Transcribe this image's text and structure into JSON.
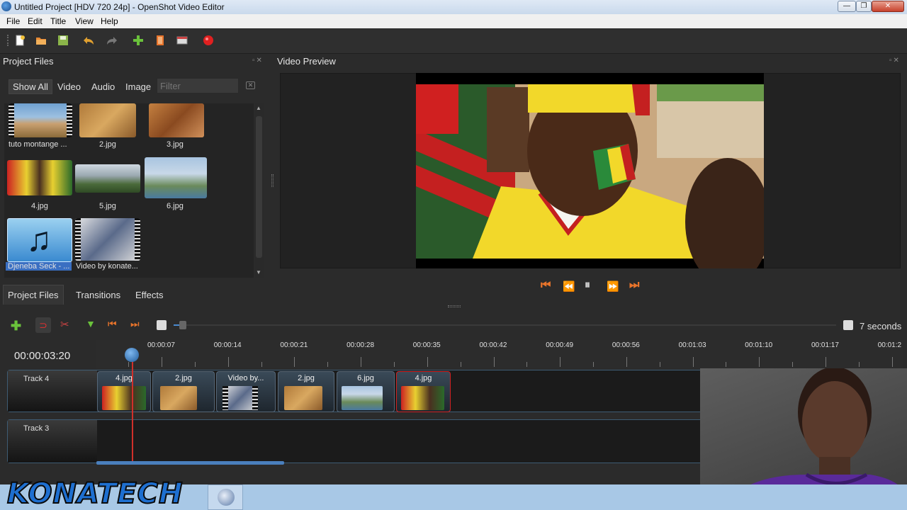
{
  "window": {
    "title": "Untitled Project [HDV 720 24p] - OpenShot Video Editor"
  },
  "menu": [
    "File",
    "Edit",
    "Title",
    "View",
    "Help"
  ],
  "project_files": {
    "title": "Project Files",
    "filters": [
      "Show All",
      "Video",
      "Audio",
      "Image"
    ],
    "filter_placeholder": "Filter",
    "items": [
      {
        "label": "tuto montange ...",
        "type": "video"
      },
      {
        "label": "2.jpg",
        "type": "image"
      },
      {
        "label": "3.jpg",
        "type": "image"
      },
      {
        "label": "4.jpg",
        "type": "image"
      },
      {
        "label": "5.jpg",
        "type": "image"
      },
      {
        "label": "6.jpg",
        "type": "image"
      },
      {
        "label": "Djeneba Seck - ...",
        "type": "audio",
        "selected": true
      },
      {
        "label": "Video by konate...",
        "type": "video"
      }
    ]
  },
  "video_preview": {
    "title": "Video Preview"
  },
  "bottom_tabs": [
    "Project Files",
    "Transitions",
    "Effects"
  ],
  "timeline": {
    "zoom_label": "7 seconds",
    "current_time": "00:00:03:20",
    "ruler_labels": [
      "00:00:07",
      "00:00:14",
      "00:00:21",
      "00:00:28",
      "00:00:35",
      "00:00:42",
      "00:00:49",
      "00:00:56",
      "00:01:03",
      "00:01:10",
      "00:01:17",
      "00:01:2"
    ],
    "tracks": [
      {
        "name": "Track 4",
        "clips": [
          "4.jpg",
          "2.jpg",
          "Video by...",
          "2.jpg",
          "6.jpg",
          "4.jpg"
        ]
      },
      {
        "name": "Track 3",
        "clips": []
      }
    ]
  },
  "watermark": {
    "text": "KONATECH"
  },
  "colors": {
    "accent": "#e8742b",
    "playhead": "#d0302a",
    "selection": "#3a6fc2"
  }
}
